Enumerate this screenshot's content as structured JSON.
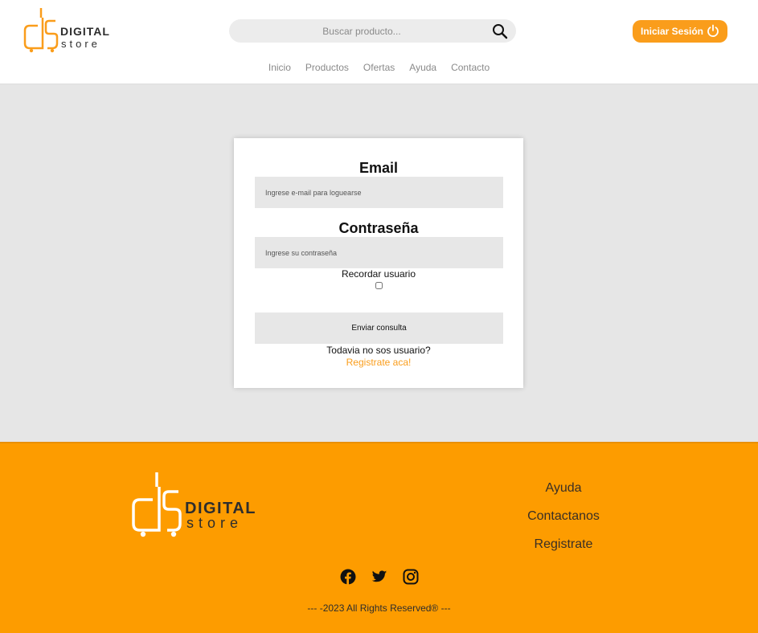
{
  "header": {
    "logo_top": "DIGITAL",
    "logo_bottom": "store",
    "search_placeholder": "Buscar producto...",
    "login_label": "Iniciar Sesión",
    "nav": [
      "Inicio",
      "Productos",
      "Ofertas",
      "Ayuda",
      "Contacto"
    ]
  },
  "login": {
    "email_label": "Email",
    "email_placeholder": "Ingrese e-mail para loguearse",
    "password_label": "Contraseña",
    "password_placeholder": "Ingrese su contraseña",
    "remember_label": "Recordar usuario",
    "submit_label": "Enviar consulta",
    "no_account_text": "Todavia no sos usuario?",
    "register_link": "Registrate aca!"
  },
  "footer": {
    "logo_top": "DIGITAL",
    "logo_bottom": "store",
    "links": [
      "Ayuda",
      "Contactanos",
      "Registrate"
    ],
    "socials": [
      "facebook-icon",
      "twitter-icon",
      "instagram-icon"
    ],
    "copyright": "--- -2023 All Rights Reserved® ---"
  },
  "colors": {
    "accent": "#fa9d1b",
    "footer_bg": "#fd9c00",
    "page_bg": "#e6e6e6"
  }
}
